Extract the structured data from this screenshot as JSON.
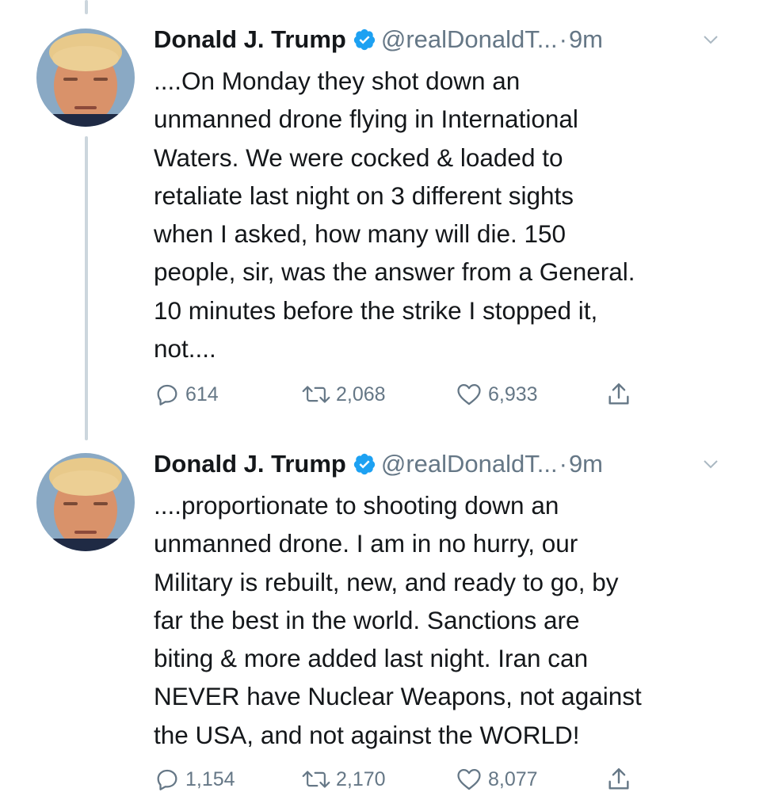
{
  "tweets": [
    {
      "author": {
        "name": "Donald J. Trump",
        "handle": "@realDonaldT...",
        "time": "9m",
        "separator": "·"
      },
      "text": "....On Monday they shot down an\nunmanned drone flying in International\nWaters. We were cocked & loaded to\nretaliate last night on 3 different sights\nwhen I asked, how many will die. 150\npeople, sir, was the answer from a General.\n10 minutes before the strike I stopped it,\nnot....",
      "replies": "614",
      "retweets": "2,068",
      "likes": "6,933"
    },
    {
      "author": {
        "name": "Donald J. Trump",
        "handle": "@realDonaldT...",
        "time": "9m",
        "separator": "·"
      },
      "text": "....proportionate to shooting down an\nunmanned drone. I am in no hurry, our\nMilitary is rebuilt, new,  and ready to go, by\nfar the best in the world. Sanctions are\nbiting & more added last night. Iran can\nNEVER have Nuclear Weapons, not against\nthe USA, and not against the WORLD!",
      "replies": "1,154",
      "retweets": "2,170",
      "likes": "8,077"
    }
  ],
  "icons": {
    "verified": "verified-badge-icon",
    "menu": "chevron-down-icon",
    "reply": "reply-icon",
    "retweet": "retweet-icon",
    "like": "heart-icon",
    "share": "share-icon"
  },
  "colors": {
    "text": "#14171a",
    "secondary": "#657786",
    "verified": "#1da1f2",
    "thread_line": "#ccd6dd"
  }
}
